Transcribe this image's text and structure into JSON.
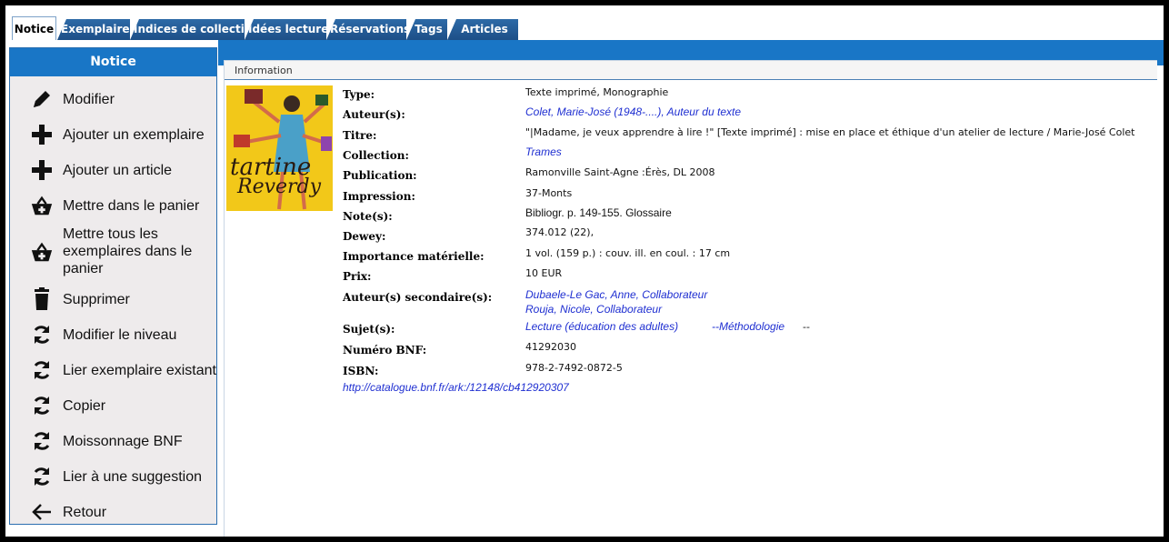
{
  "tabs": [
    "Notice",
    "Exemplaires",
    "Indices de collection",
    "Idées lectures",
    "Réservations",
    "Tags",
    "Articles"
  ],
  "sidebar": {
    "title": "Notice",
    "items": [
      {
        "label": "Modifier",
        "icon": "pencil-icon"
      },
      {
        "label": "Ajouter un exemplaire",
        "icon": "plus-icon"
      },
      {
        "label": "Ajouter un article",
        "icon": "plus-icon"
      },
      {
        "label": "Mettre dans le panier",
        "icon": "basket-icon"
      },
      {
        "label": "Mettre tous les exemplaires dans le panier",
        "icon": "basket-icon"
      },
      {
        "label": "Supprimer",
        "icon": "trash-icon"
      },
      {
        "label": "Modifier le niveau",
        "icon": "refresh-icon"
      },
      {
        "label": "Lier exemplaire existant",
        "icon": "refresh-icon"
      },
      {
        "label": "Copier",
        "icon": "refresh-icon"
      },
      {
        "label": "Moissonnage BNF",
        "icon": "refresh-icon"
      },
      {
        "label": "Lier à une suggestion",
        "icon": "refresh-icon"
      },
      {
        "label": "Retour",
        "icon": "arrow-left-icon"
      }
    ]
  },
  "info": {
    "header": "Information",
    "cover": {
      "title_line1": "tartine",
      "title_line2": "Reverdy"
    },
    "fields": {
      "type": {
        "label": "Type:",
        "value": "Texte imprimé, Monographie"
      },
      "authors": {
        "label": "Auteur(s):",
        "value": "Colet, Marie-José (1948-....), Auteur du texte"
      },
      "title": {
        "label": "Titre:",
        "value": "\"|Madame, je veux apprendre à lire !\" [Texte imprimé] : mise en place et éthique d'un atelier de lecture / Marie-José Colet"
      },
      "collection": {
        "label": "Collection:",
        "value": "Trames"
      },
      "publication": {
        "label": "Publication:",
        "value": "Ramonville Saint-Agne :Érès, DL 2008"
      },
      "impression": {
        "label": "Impression:",
        "value": "37-Monts"
      },
      "notes": {
        "label": "Note(s):",
        "value": "Bibliogr. p. 149-155. Glossaire"
      },
      "dewey": {
        "label": "Dewey:",
        "value": "374.012 (22),"
      },
      "material": {
        "label": "Importance matérielle:",
        "value": "1 vol. (159 p.) : couv. ill. en coul. : 17 cm"
      },
      "price": {
        "label": "Prix:",
        "value": "10 EUR"
      },
      "secondary": {
        "label": "Auteur(s) secondaire(s):",
        "value1": "Dubaele-Le Gac, Anne, Collaborateur",
        "value2": "Rouja, Nicole, Collaborateur"
      },
      "subjects": {
        "label": "Sujet(s):",
        "value1": "Lecture (éducation des adultes)",
        "value2": "--Méthodologie",
        "value3": "--"
      },
      "bnf_number": {
        "label": "Numéro BNF:",
        "value": "41292030"
      },
      "isbn": {
        "label": "ISBN:",
        "value": "978-2-7492-0872-5"
      }
    },
    "bnf_link": "http://catalogue.bnf.fr/ark:/12148/cb412920307"
  },
  "colors": {
    "accent": "#1976c6",
    "link": "#1f2fd1",
    "sidebar_bg": "#eeebec",
    "cover": "#f2c819"
  }
}
